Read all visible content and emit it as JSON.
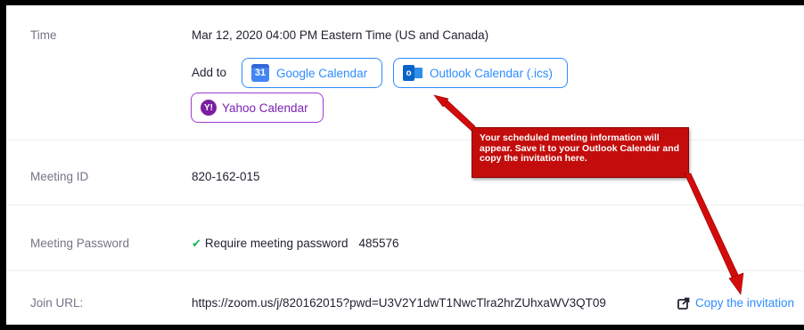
{
  "time": {
    "label": "Time",
    "value": "Mar 12, 2020 04:00 PM Eastern Time (US and Canada)",
    "add_to_label": "Add to",
    "calendars": {
      "google": {
        "label": "Google Calendar",
        "icon": "31"
      },
      "outlook": {
        "label": "Outlook Calendar (.ics)",
        "icon": "o"
      },
      "yahoo": {
        "label": "Yahoo Calendar",
        "icon": "Y!"
      }
    }
  },
  "meeting_id": {
    "label": "Meeting ID",
    "value": "820-162-015"
  },
  "meeting_password": {
    "label": "Meeting Password",
    "require_text": "Require meeting password",
    "value": "485576"
  },
  "join_url": {
    "label": "Join URL:",
    "value": "https://zoom.us/j/820162015?pwd=U3V2Y1dwT1NwcTlra2hrZUhxaWV3QT09",
    "copy_label": "Copy the invitation"
  },
  "callout": {
    "text": "Your scheduled meeting information will appear. Save it to your Outlook Calendar and copy the invitation here."
  },
  "colors": {
    "link_blue": "#2d8cff",
    "yahoo_purple": "#a03bd1",
    "callout_red": "#c30d0d",
    "check_green": "#13b75a"
  }
}
